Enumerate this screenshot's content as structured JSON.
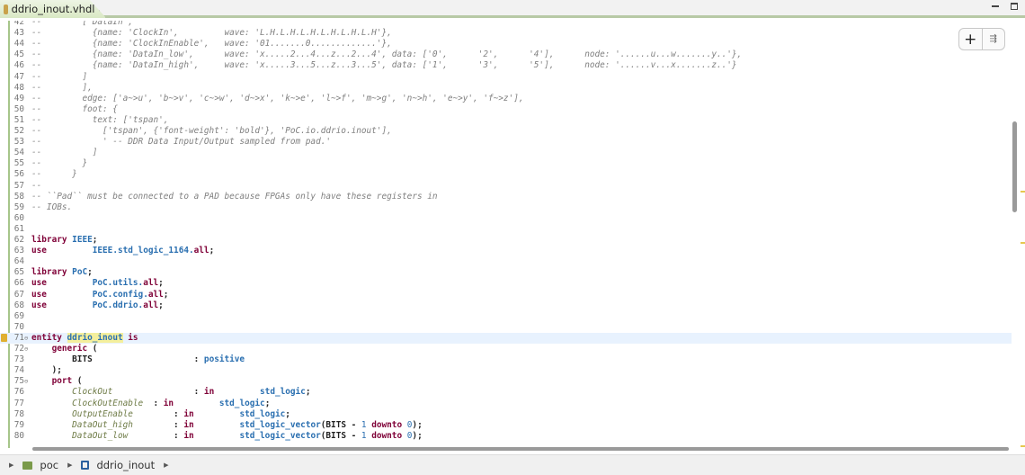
{
  "tab": {
    "title": "ddrio_inout.vhdl",
    "close": "⊠"
  },
  "toolbox": {
    "add": "+",
    "filter": "⇶"
  },
  "breadcrumb": [
    "poc",
    "ddrio_inout"
  ],
  "lines": [
    {
      "n": "42",
      "s": [
        [
          "--        ['DataIn',",
          "c"
        ]
      ]
    },
    {
      "n": "43",
      "s": [
        [
          "--          {name: 'ClockIn',         wave: 'L.H.L.H.L.H.L.H.L.H.L.H'},",
          "c"
        ]
      ]
    },
    {
      "n": "44",
      "s": [
        [
          "--          {name: 'ClockInEnable',   wave: '01.......0.............'},",
          "c"
        ]
      ]
    },
    {
      "n": "45",
      "s": [
        [
          "--          {name: 'DataIn_low',      wave: 'x.....2...4...z...2...4', data: ['0',      '2',      '4'],      node: '......u...w.......y..'},",
          "c"
        ]
      ]
    },
    {
      "n": "46",
      "s": [
        [
          "--          {name: 'DataIn_high',     wave: 'x.....3...5...z...3...5', data: ['1',      '3',      '5'],      node: '......v...x.......z..'}",
          "c"
        ]
      ]
    },
    {
      "n": "47",
      "s": [
        [
          "--        ]",
          "c"
        ]
      ]
    },
    {
      "n": "48",
      "s": [
        [
          "--        ],",
          "c"
        ]
      ]
    },
    {
      "n": "49",
      "s": [
        [
          "--        edge: ['a~>u', 'b~>v', 'c~>w', 'd~>x', 'k~>e', 'l~>f', 'm~>g', 'n~>h', 'e~>y', 'f~>z'],",
          "c"
        ]
      ]
    },
    {
      "n": "50",
      "s": [
        [
          "--        foot: {",
          "c"
        ]
      ]
    },
    {
      "n": "51",
      "s": [
        [
          "--          text: ['tspan',",
          "c"
        ]
      ]
    },
    {
      "n": "52",
      "s": [
        [
          "--            ['tspan', {'font-weight': 'bold'}, 'PoC.io.ddrio.inout'],",
          "c"
        ]
      ]
    },
    {
      "n": "53",
      "s": [
        [
          "--            ' -- DDR Data Input/Output sampled from pad.'",
          "c"
        ]
      ]
    },
    {
      "n": "54",
      "s": [
        [
          "--          ]",
          "c"
        ]
      ]
    },
    {
      "n": "55",
      "s": [
        [
          "--        }",
          "c"
        ]
      ]
    },
    {
      "n": "56",
      "s": [
        [
          "--      }",
          "c"
        ]
      ]
    },
    {
      "n": "57",
      "s": [
        [
          "--",
          "c"
        ]
      ]
    },
    {
      "n": "58",
      "s": [
        [
          "-- ``Pad`` must be connected to a PAD because FPGAs only have these registers in",
          "c"
        ]
      ]
    },
    {
      "n": "59",
      "s": [
        [
          "-- IOBs.",
          "c"
        ]
      ]
    },
    {
      "n": "60",
      "s": []
    },
    {
      "n": "61",
      "s": []
    },
    {
      "n": "62",
      "s": [
        [
          "library",
          "k"
        ],
        [
          " ",
          ""
        ],
        [
          "IEEE",
          "t"
        ],
        [
          ";",
          "n"
        ]
      ]
    },
    {
      "n": "63",
      "s": [
        [
          "use",
          "k"
        ],
        [
          "         ",
          ""
        ],
        [
          "IEEE.std_logic_1164.",
          "t"
        ],
        [
          "all",
          "k"
        ],
        [
          ";",
          "n"
        ]
      ]
    },
    {
      "n": "64",
      "s": []
    },
    {
      "n": "65",
      "s": [
        [
          "library",
          "k"
        ],
        [
          " ",
          ""
        ],
        [
          "PoC",
          "t"
        ],
        [
          ";",
          "n"
        ]
      ]
    },
    {
      "n": "66",
      "s": [
        [
          "use",
          "k"
        ],
        [
          "         ",
          ""
        ],
        [
          "PoC.utils.",
          "t"
        ],
        [
          "all",
          "k"
        ],
        [
          ";",
          "n"
        ]
      ]
    },
    {
      "n": "67",
      "s": [
        [
          "use",
          "k"
        ],
        [
          "         ",
          ""
        ],
        [
          "PoC.config.",
          "t"
        ],
        [
          "all",
          "k"
        ],
        [
          ";",
          "n"
        ]
      ]
    },
    {
      "n": "68",
      "s": [
        [
          "use",
          "k"
        ],
        [
          "         ",
          ""
        ],
        [
          "PoC.ddrio.",
          "t"
        ],
        [
          "all",
          "k"
        ],
        [
          ";",
          "n"
        ]
      ]
    },
    {
      "n": "69",
      "s": []
    },
    {
      "n": "70",
      "s": []
    },
    {
      "n": "71",
      "fold": true,
      "hl": true,
      "warn": true,
      "s": [
        [
          "entity",
          "k"
        ],
        [
          " ",
          ""
        ],
        [
          "ddrio_inout",
          "t mark"
        ],
        [
          " ",
          ""
        ],
        [
          "is",
          "k"
        ]
      ]
    },
    {
      "n": "72",
      "fold": true,
      "s": [
        [
          "    ",
          ""
        ],
        [
          "generic",
          "k"
        ],
        [
          " (",
          "n"
        ]
      ]
    },
    {
      "n": "73",
      "s": [
        [
          "        ",
          ""
        ],
        [
          "BITS",
          "n"
        ],
        [
          "                    ",
          ""
        ],
        [
          ": ",
          "n"
        ],
        [
          "positive",
          "t"
        ]
      ]
    },
    {
      "n": "74",
      "s": [
        [
          "    );",
          "n"
        ]
      ]
    },
    {
      "n": "75",
      "fold": true,
      "s": [
        [
          "    ",
          ""
        ],
        [
          "port",
          "k"
        ],
        [
          " (",
          "n"
        ]
      ]
    },
    {
      "n": "76",
      "s": [
        [
          "        ",
          ""
        ],
        [
          "ClockOut",
          "p"
        ],
        [
          "                ",
          ""
        ],
        [
          ": ",
          "n"
        ],
        [
          "in",
          "k"
        ],
        [
          "         ",
          ""
        ],
        [
          "std_logic",
          "t"
        ],
        [
          ";",
          "n"
        ]
      ]
    },
    {
      "n": "77",
      "s": [
        [
          "        ",
          ""
        ],
        [
          "ClockOutEnable",
          "p"
        ],
        [
          "  : ",
          "n"
        ],
        [
          "in",
          "k"
        ],
        [
          "         ",
          ""
        ],
        [
          "std_logic",
          "t"
        ],
        [
          ";",
          "n"
        ]
      ]
    },
    {
      "n": "78",
      "s": [
        [
          "        ",
          ""
        ],
        [
          "OutputEnable",
          "p"
        ],
        [
          "        : ",
          "n"
        ],
        [
          "in",
          "k"
        ],
        [
          "         ",
          ""
        ],
        [
          "std_logic",
          "t"
        ],
        [
          ";",
          "n"
        ]
      ]
    },
    {
      "n": "79",
      "s": [
        [
          "        ",
          ""
        ],
        [
          "DataOut_high",
          "p"
        ],
        [
          "        : ",
          "n"
        ],
        [
          "in",
          "k"
        ],
        [
          "         ",
          ""
        ],
        [
          "std_logic_vector",
          "t"
        ],
        [
          "(BITS - ",
          "n"
        ],
        [
          "1",
          "num"
        ],
        [
          " ",
          ""
        ],
        [
          "downto",
          "k"
        ],
        [
          " ",
          ""
        ],
        [
          "0",
          "num"
        ],
        [
          ");",
          "n"
        ]
      ]
    },
    {
      "n": "80",
      "s": [
        [
          "        ",
          ""
        ],
        [
          "DataOut_low",
          "p"
        ],
        [
          "         : ",
          "n"
        ],
        [
          "in",
          "k"
        ],
        [
          "         ",
          ""
        ],
        [
          "std_logic_vector",
          "t"
        ],
        [
          "(BITS - ",
          "n"
        ],
        [
          "1",
          "num"
        ],
        [
          " ",
          ""
        ],
        [
          "downto",
          "k"
        ],
        [
          " ",
          ""
        ],
        [
          "0",
          "num"
        ],
        [
          ");",
          "n"
        ]
      ]
    }
  ]
}
